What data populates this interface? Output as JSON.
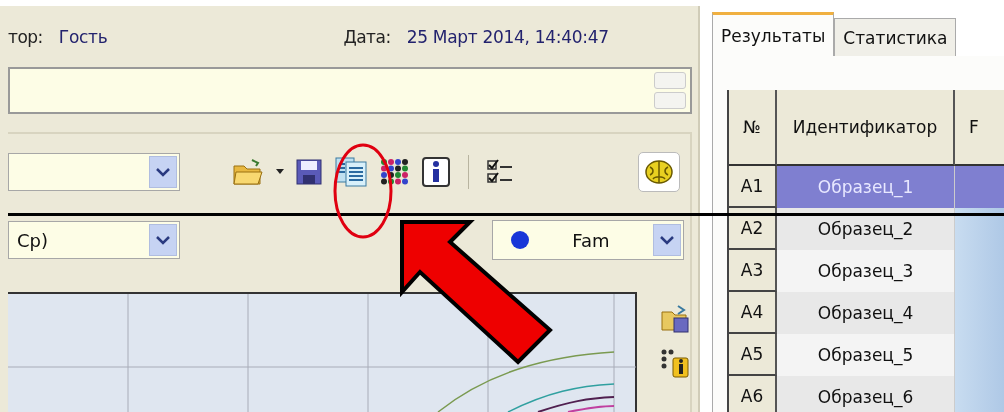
{
  "header": {
    "operator_label": "тор:",
    "operator": "Гость",
    "date_label": "Дата:",
    "date": "25 Март 2014, 14:40:47"
  },
  "toolbar": {
    "items": [
      {
        "kind": "folder"
      },
      {
        "kind": "caret"
      },
      {
        "kind": "save"
      },
      {
        "kind": "copy"
      },
      {
        "kind": "grid"
      },
      {
        "kind": "info"
      },
      {
        "kind": "separator"
      },
      {
        "kind": "checklist"
      },
      {
        "kind": "brain"
      }
    ]
  },
  "filters": {
    "curve_select": {
      "value": "Cp)"
    },
    "channel_select": {
      "value": "Fam",
      "color": "#1836d8"
    }
  },
  "tabs": [
    {
      "label": "Результаты",
      "selected": true
    },
    {
      "label": "Статистика",
      "selected": false
    }
  ],
  "table": {
    "columns": [
      "№",
      "Идентификатор",
      "F"
    ],
    "rows": [
      {
        "well": "A1",
        "name": "Образец_1",
        "selected": true
      },
      {
        "well": "A2",
        "name": "Образец_2",
        "selected": false
      },
      {
        "well": "A3",
        "name": "Образец_3",
        "selected": false
      },
      {
        "well": "A4",
        "name": "Образец_4",
        "selected": false
      },
      {
        "well": "A5",
        "name": "Образец_5",
        "selected": false
      },
      {
        "well": "A6",
        "name": "Образец_6",
        "selected": false
      }
    ]
  }
}
